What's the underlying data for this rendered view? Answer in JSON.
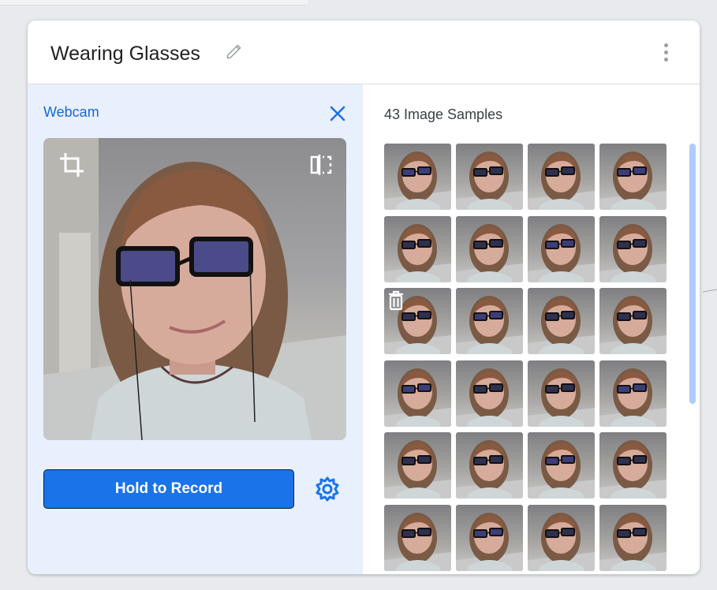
{
  "card": {
    "title": "Wearing Glasses",
    "edit_icon": "pencil-icon",
    "menu_icon": "more-vert-icon"
  },
  "webcam": {
    "label": "Webcam",
    "close_icon": "close-icon",
    "crop_icon": "crop-icon",
    "flip_icon": "flip-icon",
    "record_label": "Hold to Record",
    "settings_icon": "gear-icon"
  },
  "samples": {
    "label": "43 Image Samples",
    "visible_rows": 6,
    "visible_cols": 4,
    "hovered_thumb_index": 8,
    "hover_icon": "trash-icon"
  },
  "colors": {
    "accent": "#1a73e8",
    "link": "#1967d2",
    "panel_bg": "#e8f0fe",
    "scrollbar": "#aecbfa"
  }
}
